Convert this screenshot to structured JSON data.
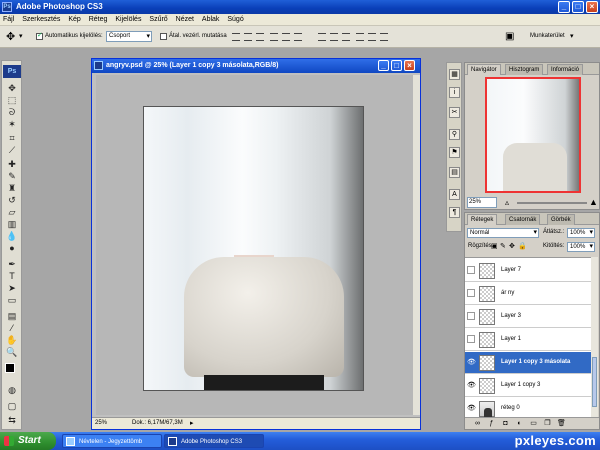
{
  "app": {
    "title": "Adobe Photoshop CS3"
  },
  "menu": [
    "Fájl",
    "Szerkesztés",
    "Kép",
    "Réteg",
    "Kijelölés",
    "Szűrő",
    "Nézet",
    "Ablak",
    "Súgó"
  ],
  "options": {
    "auto_select_label": "Automatikus kijelölés:",
    "auto_select_value": "Csoport",
    "transform_label": "Átal. vezérl. mutatása",
    "workspace_label": "Munkaterület"
  },
  "document": {
    "title": "angryv.psd @ 25% (Layer 1 copy 3 másolata,RGB/8)",
    "zoom": "25%",
    "doc_info": "Dok.: 6,17M/67,3M"
  },
  "navigator": {
    "tabs": [
      "Navigátor",
      "Hisztogram",
      "Információ"
    ],
    "zoom": "25%"
  },
  "layers_panel": {
    "tabs": [
      "Rétegek",
      "Csatornák",
      "Görbék"
    ],
    "blend_mode": "Normál",
    "opacity_label": "Átlátsz.:",
    "opacity_value": "100%",
    "lock_label": "Rögzítés:",
    "fill_label": "Kitöltés:",
    "fill_value": "100%",
    "layers": [
      {
        "name": "Layer 7",
        "visible": false,
        "selected": false
      },
      {
        "name": "ár ny",
        "visible": false,
        "selected": false
      },
      {
        "name": "Layer 3",
        "visible": false,
        "selected": false
      },
      {
        "name": "Layer 1",
        "visible": false,
        "selected": false
      },
      {
        "name": "Layer 1 copy 3 másolata",
        "visible": true,
        "selected": true
      },
      {
        "name": "Layer 1 copy 3",
        "visible": true,
        "selected": false
      },
      {
        "name": "réteg 0",
        "visible": true,
        "selected": false
      }
    ]
  },
  "taskbar": {
    "start": "Start",
    "items": [
      "Névtelen - Jegyzettömb",
      "Adobe Photoshop CS3"
    ],
    "watermark": "pxleyes.com"
  }
}
